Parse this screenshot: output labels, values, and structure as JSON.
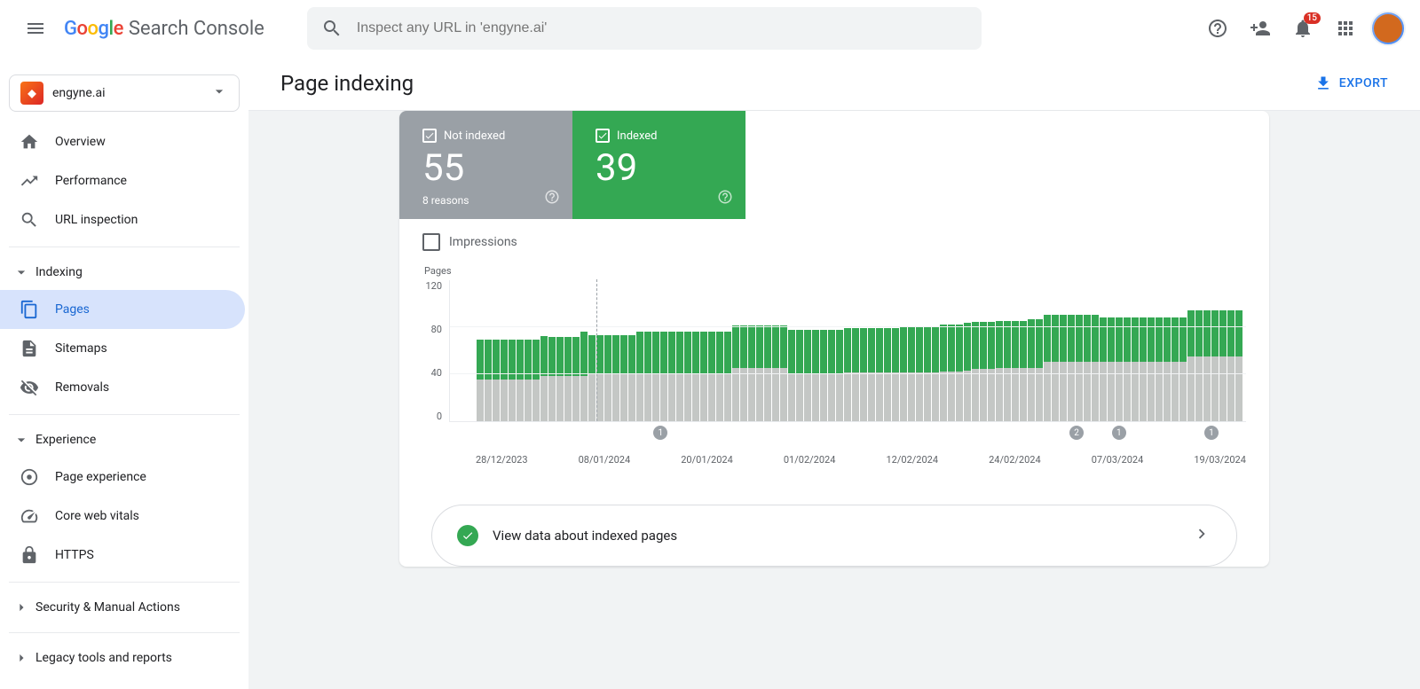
{
  "header": {
    "product": "Search Console",
    "search_placeholder": "Inspect any URL in 'engyne.ai'",
    "notification_count": "15"
  },
  "property": {
    "name": "engyne.ai"
  },
  "sidebar": {
    "overview": "Overview",
    "performance": "Performance",
    "url_inspection": "URL inspection",
    "section_indexing": "Indexing",
    "pages": "Pages",
    "sitemaps": "Sitemaps",
    "removals": "Removals",
    "section_experience": "Experience",
    "page_experience": "Page experience",
    "core_web_vitals": "Core web vitals",
    "https": "HTTPS",
    "section_security": "Security & Manual Actions",
    "section_legacy": "Legacy tools and reports"
  },
  "page": {
    "title": "Page indexing",
    "export": "EXPORT"
  },
  "stats": {
    "not_indexed": {
      "label": "Not indexed",
      "value": "55",
      "sub": "8 reasons"
    },
    "indexed": {
      "label": "Indexed",
      "value": "39"
    }
  },
  "impressions_label": "Impressions",
  "chart_data": {
    "type": "bar",
    "ylabel": "Pages",
    "ylim": [
      0,
      120
    ],
    "yticks": [
      "120",
      "80",
      "40",
      "0"
    ],
    "xticks": [
      "28/12/2023",
      "08/01/2024",
      "20/01/2024",
      "01/02/2024",
      "12/02/2024",
      "24/02/2024",
      "07/03/2024",
      "19/03/2024"
    ],
    "series": [
      {
        "name": "Indexed",
        "color": "#34a853"
      },
      {
        "name": "Not indexed",
        "color": "#c4c7c5"
      }
    ],
    "event_markers": [
      {
        "position_pct": 24,
        "label": "1"
      },
      {
        "position_pct": 78,
        "label": "2"
      },
      {
        "position_pct": 83.5,
        "label": "1"
      },
      {
        "position_pct": 95.5,
        "label": "1"
      }
    ],
    "vline_pct": 15,
    "bars": [
      {
        "indexed": 34,
        "not_indexed": 35
      },
      {
        "indexed": 34,
        "not_indexed": 35
      },
      {
        "indexed": 34,
        "not_indexed": 35
      },
      {
        "indexed": 34,
        "not_indexed": 35
      },
      {
        "indexed": 34,
        "not_indexed": 35
      },
      {
        "indexed": 34,
        "not_indexed": 35
      },
      {
        "indexed": 34,
        "not_indexed": 35
      },
      {
        "indexed": 34,
        "not_indexed": 35
      },
      {
        "indexed": 34,
        "not_indexed": 38
      },
      {
        "indexed": 33,
        "not_indexed": 38
      },
      {
        "indexed": 33,
        "not_indexed": 38
      },
      {
        "indexed": 33,
        "not_indexed": 38
      },
      {
        "indexed": 33,
        "not_indexed": 38
      },
      {
        "indexed": 38,
        "not_indexed": 38
      },
      {
        "indexed": 33,
        "not_indexed": 40
      },
      {
        "indexed": 33,
        "not_indexed": 40
      },
      {
        "indexed": 33,
        "not_indexed": 40
      },
      {
        "indexed": 33,
        "not_indexed": 40
      },
      {
        "indexed": 33,
        "not_indexed": 40
      },
      {
        "indexed": 33,
        "not_indexed": 40
      },
      {
        "indexed": 36,
        "not_indexed": 40
      },
      {
        "indexed": 36,
        "not_indexed": 40
      },
      {
        "indexed": 36,
        "not_indexed": 40
      },
      {
        "indexed": 36,
        "not_indexed": 40
      },
      {
        "indexed": 36,
        "not_indexed": 40
      },
      {
        "indexed": 36,
        "not_indexed": 40
      },
      {
        "indexed": 36,
        "not_indexed": 40
      },
      {
        "indexed": 36,
        "not_indexed": 40
      },
      {
        "indexed": 36,
        "not_indexed": 40
      },
      {
        "indexed": 36,
        "not_indexed": 40
      },
      {
        "indexed": 36,
        "not_indexed": 40
      },
      {
        "indexed": 36,
        "not_indexed": 40
      },
      {
        "indexed": 36,
        "not_indexed": 45
      },
      {
        "indexed": 36,
        "not_indexed": 45
      },
      {
        "indexed": 36,
        "not_indexed": 45
      },
      {
        "indexed": 36,
        "not_indexed": 45
      },
      {
        "indexed": 36,
        "not_indexed": 45
      },
      {
        "indexed": 36,
        "not_indexed": 45
      },
      {
        "indexed": 36,
        "not_indexed": 45
      },
      {
        "indexed": 37,
        "not_indexed": 40
      },
      {
        "indexed": 37,
        "not_indexed": 40
      },
      {
        "indexed": 37,
        "not_indexed": 40
      },
      {
        "indexed": 37,
        "not_indexed": 40
      },
      {
        "indexed": 37,
        "not_indexed": 40
      },
      {
        "indexed": 37,
        "not_indexed": 40
      },
      {
        "indexed": 37,
        "not_indexed": 40
      },
      {
        "indexed": 38,
        "not_indexed": 41
      },
      {
        "indexed": 38,
        "not_indexed": 41
      },
      {
        "indexed": 38,
        "not_indexed": 41
      },
      {
        "indexed": 38,
        "not_indexed": 41
      },
      {
        "indexed": 38,
        "not_indexed": 41
      },
      {
        "indexed": 38,
        "not_indexed": 41
      },
      {
        "indexed": 38,
        "not_indexed": 41
      },
      {
        "indexed": 39,
        "not_indexed": 41
      },
      {
        "indexed": 39,
        "not_indexed": 41
      },
      {
        "indexed": 39,
        "not_indexed": 41
      },
      {
        "indexed": 39,
        "not_indexed": 41
      },
      {
        "indexed": 39,
        "not_indexed": 41
      },
      {
        "indexed": 40,
        "not_indexed": 42
      },
      {
        "indexed": 40,
        "not_indexed": 42
      },
      {
        "indexed": 40,
        "not_indexed": 42
      },
      {
        "indexed": 40,
        "not_indexed": 43
      },
      {
        "indexed": 40,
        "not_indexed": 44
      },
      {
        "indexed": 40,
        "not_indexed": 44
      },
      {
        "indexed": 40,
        "not_indexed": 44
      },
      {
        "indexed": 40,
        "not_indexed": 45
      },
      {
        "indexed": 40,
        "not_indexed": 45
      },
      {
        "indexed": 40,
        "not_indexed": 45
      },
      {
        "indexed": 40,
        "not_indexed": 45
      },
      {
        "indexed": 41,
        "not_indexed": 45
      },
      {
        "indexed": 41,
        "not_indexed": 45
      },
      {
        "indexed": 40,
        "not_indexed": 50
      },
      {
        "indexed": 40,
        "not_indexed": 50
      },
      {
        "indexed": 40,
        "not_indexed": 50
      },
      {
        "indexed": 40,
        "not_indexed": 50
      },
      {
        "indexed": 40,
        "not_indexed": 50
      },
      {
        "indexed": 40,
        "not_indexed": 50
      },
      {
        "indexed": 40,
        "not_indexed": 50
      },
      {
        "indexed": 38,
        "not_indexed": 50
      },
      {
        "indexed": 38,
        "not_indexed": 50
      },
      {
        "indexed": 38,
        "not_indexed": 50
      },
      {
        "indexed": 38,
        "not_indexed": 50
      },
      {
        "indexed": 38,
        "not_indexed": 50
      },
      {
        "indexed": 38,
        "not_indexed": 50
      },
      {
        "indexed": 38,
        "not_indexed": 50
      },
      {
        "indexed": 38,
        "not_indexed": 50
      },
      {
        "indexed": 38,
        "not_indexed": 50
      },
      {
        "indexed": 38,
        "not_indexed": 50
      },
      {
        "indexed": 38,
        "not_indexed": 50
      },
      {
        "indexed": 39,
        "not_indexed": 55
      },
      {
        "indexed": 39,
        "not_indexed": 55
      },
      {
        "indexed": 39,
        "not_indexed": 55
      },
      {
        "indexed": 39,
        "not_indexed": 55
      },
      {
        "indexed": 39,
        "not_indexed": 55
      },
      {
        "indexed": 39,
        "not_indexed": 55
      },
      {
        "indexed": 39,
        "not_indexed": 55
      }
    ]
  },
  "view_data_label": "View data about indexed pages"
}
